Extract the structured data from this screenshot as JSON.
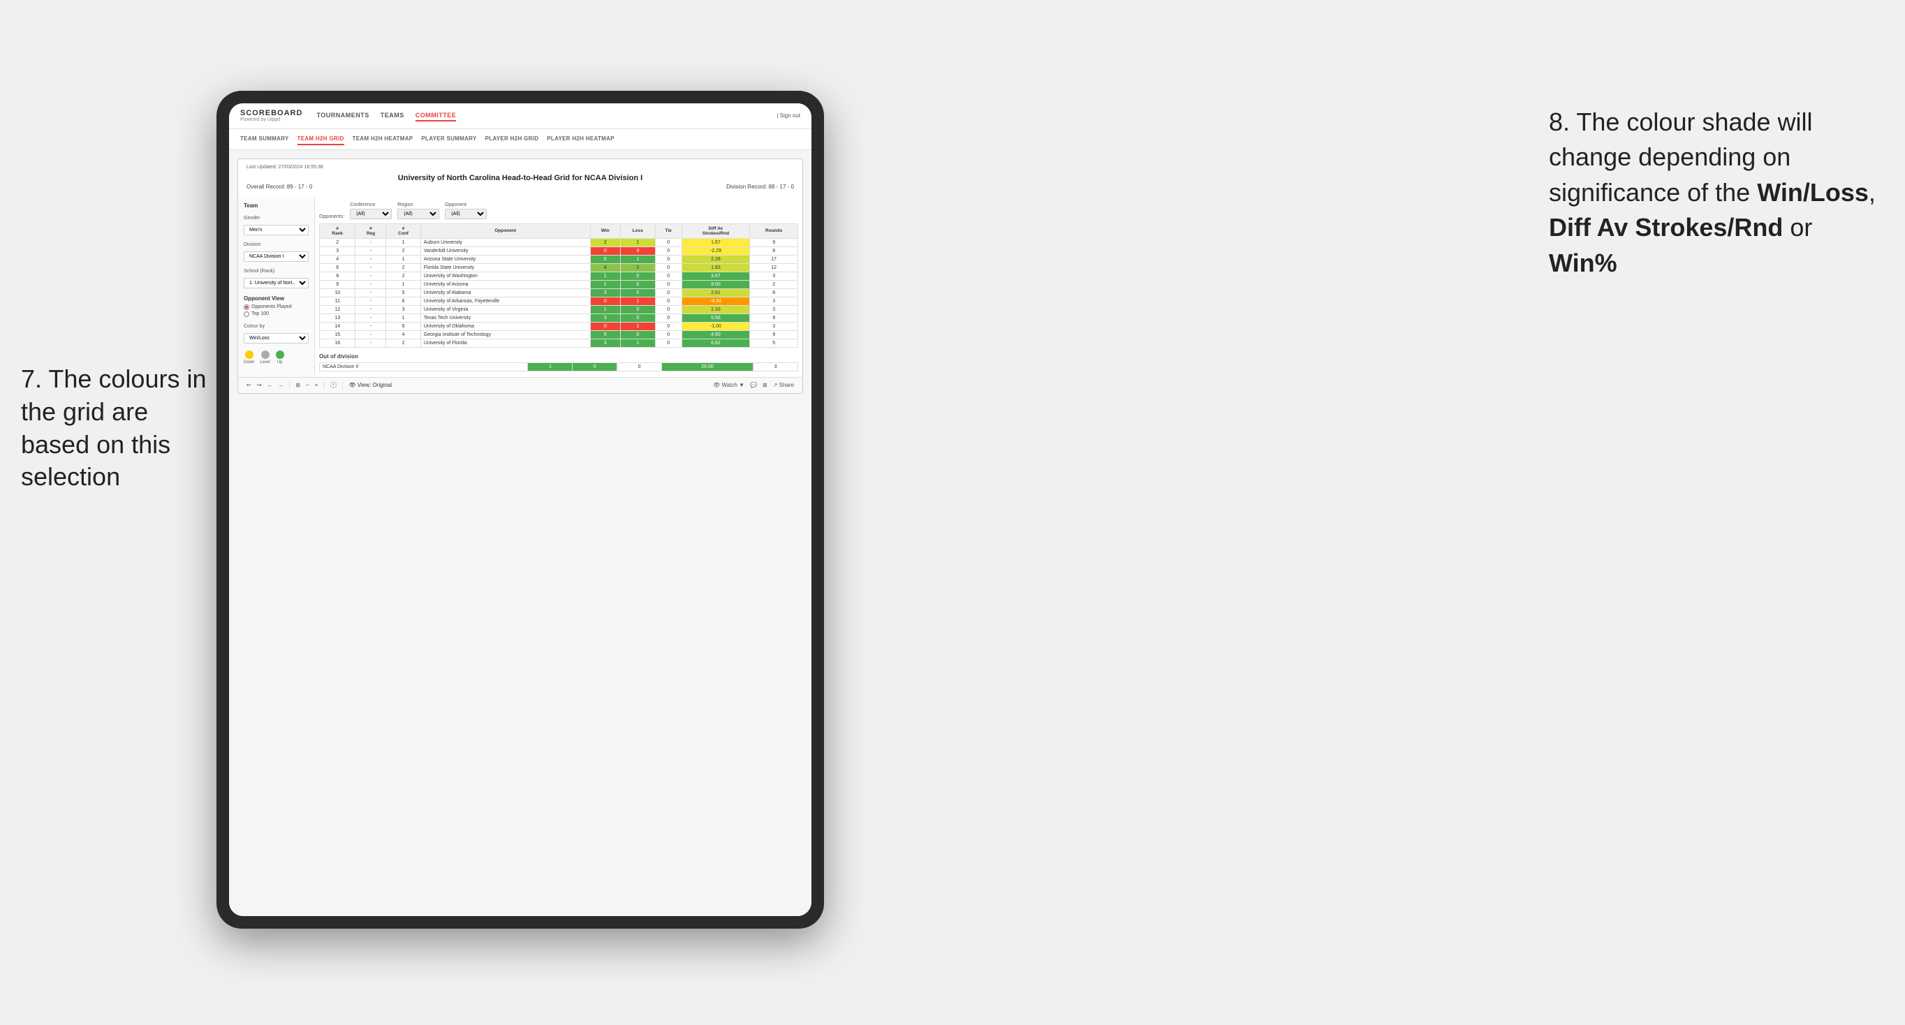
{
  "annotations": {
    "left": {
      "text": "7. The colours in the grid are based on this selection"
    },
    "right": {
      "intro": "8. The colour shade will change depending on significance of the ",
      "bold1": "Win/Loss",
      "sep1": ", ",
      "bold2": "Diff Av Strokes/Rnd",
      "sep2": " or ",
      "bold3": "Win%"
    }
  },
  "nav": {
    "logo": "SCOREBOARD",
    "logo_sub": "Powered by clippd",
    "items": [
      "TOURNAMENTS",
      "TEAMS",
      "COMMITTEE"
    ],
    "sign_out": "Sign out"
  },
  "subnav": {
    "items": [
      "TEAM SUMMARY",
      "TEAM H2H GRID",
      "TEAM H2H HEATMAP",
      "PLAYER SUMMARY",
      "PLAYER H2H GRID",
      "PLAYER H2H HEATMAP"
    ],
    "active": "TEAM H2H GRID"
  },
  "report": {
    "timestamp": "Last Updated: 27/03/2024 16:55:38",
    "title": "University of North Carolina Head-to-Head Grid for NCAA Division I",
    "overall_record": "Overall Record: 89 - 17 - 0",
    "division_record": "Division Record: 88 - 17 - 0"
  },
  "filters": {
    "conference_label": "Conference",
    "conference_value": "(All)",
    "region_label": "Region",
    "region_value": "(All)",
    "opponent_label": "Opponent",
    "opponent_value": "(All)",
    "opponents_label": "Opponents:"
  },
  "side_panel": {
    "team_label": "Team",
    "gender_label": "Gender",
    "gender_value": "Men's",
    "division_label": "Division",
    "division_value": "NCAA Division I",
    "school_label": "School (Rank)",
    "school_value": "1. University of Nort...",
    "opponent_view_label": "Opponent View",
    "radio_options": [
      "Opponents Played",
      "Top 100"
    ],
    "colour_by_label": "Colour by",
    "colour_by_value": "Win/Loss",
    "legend": [
      {
        "label": "Down",
        "color": "#ffcc00"
      },
      {
        "label": "Level",
        "color": "#aaa"
      },
      {
        "label": "Up",
        "color": "#4caf50"
      }
    ]
  },
  "table": {
    "headers": [
      "#\nRank",
      "#\nReg",
      "#\nConf",
      "Opponent",
      "Win",
      "Loss",
      "Tie",
      "Diff Av\nStrokes/Rnd",
      "Rounds"
    ],
    "rows": [
      {
        "rank": "2",
        "reg": "-",
        "conf": "1",
        "opponent": "Auburn University",
        "win": "2",
        "loss": "1",
        "tie": "0",
        "diff": "1.67",
        "rounds": "9",
        "win_color": "green-light",
        "diff_color": "yellow"
      },
      {
        "rank": "3",
        "reg": "-",
        "conf": "2",
        "opponent": "Vanderbilt University",
        "win": "0",
        "loss": "4",
        "tie": "0",
        "diff": "-2.29",
        "rounds": "8",
        "win_color": "red",
        "diff_color": "yellow"
      },
      {
        "rank": "4",
        "reg": "-",
        "conf": "1",
        "opponent": "Arizona State University",
        "win": "5",
        "loss": "1",
        "tie": "0",
        "diff": "2.28",
        "rounds": "17",
        "win_color": "green-dark",
        "diff_color": "green-light"
      },
      {
        "rank": "6",
        "reg": "-",
        "conf": "2",
        "opponent": "Florida State University",
        "win": "4",
        "loss": "2",
        "tie": "0",
        "diff": "1.83",
        "rounds": "12",
        "win_color": "green-mid",
        "diff_color": "green-light"
      },
      {
        "rank": "8",
        "reg": "-",
        "conf": "2",
        "opponent": "University of Washington",
        "win": "1",
        "loss": "0",
        "tie": "0",
        "diff": "3.67",
        "rounds": "3",
        "win_color": "green-dark",
        "diff_color": "green-dark"
      },
      {
        "rank": "9",
        "reg": "-",
        "conf": "1",
        "opponent": "University of Arizona",
        "win": "1",
        "loss": "0",
        "tie": "0",
        "diff": "9.00",
        "rounds": "2",
        "win_color": "green-dark",
        "diff_color": "green-dark"
      },
      {
        "rank": "10",
        "reg": "-",
        "conf": "5",
        "opponent": "University of Alabama",
        "win": "3",
        "loss": "0",
        "tie": "0",
        "diff": "2.61",
        "rounds": "8",
        "win_color": "green-dark",
        "diff_color": "green-light"
      },
      {
        "rank": "11",
        "reg": "-",
        "conf": "6",
        "opponent": "University of Arkansas, Fayetteville",
        "win": "0",
        "loss": "1",
        "tie": "0",
        "diff": "-4.33",
        "rounds": "3",
        "win_color": "red",
        "diff_color": "orange"
      },
      {
        "rank": "12",
        "reg": "-",
        "conf": "3",
        "opponent": "University of Virginia",
        "win": "1",
        "loss": "0",
        "tie": "0",
        "diff": "2.33",
        "rounds": "3",
        "win_color": "green-dark",
        "diff_color": "green-light"
      },
      {
        "rank": "13",
        "reg": "-",
        "conf": "1",
        "opponent": "Texas Tech University",
        "win": "3",
        "loss": "0",
        "tie": "0",
        "diff": "5.56",
        "rounds": "9",
        "win_color": "green-dark",
        "diff_color": "green-dark"
      },
      {
        "rank": "14",
        "reg": "-",
        "conf": "6",
        "opponent": "University of Oklahoma",
        "win": "0",
        "loss": "1",
        "tie": "0",
        "diff": "-1.00",
        "rounds": "3",
        "win_color": "red",
        "diff_color": "yellow"
      },
      {
        "rank": "15",
        "reg": "-",
        "conf": "4",
        "opponent": "Georgia Institute of Technology",
        "win": "5",
        "loss": "0",
        "tie": "0",
        "diff": "4.50",
        "rounds": "9",
        "win_color": "green-dark",
        "diff_color": "green-dark"
      },
      {
        "rank": "16",
        "reg": "-",
        "conf": "2",
        "opponent": "University of Florida",
        "win": "3",
        "loss": "1",
        "tie": "0",
        "diff": "6.62",
        "rounds": "5",
        "win_color": "green-dark",
        "diff_color": "green-dark"
      }
    ]
  },
  "out_of_division": {
    "label": "Out of division",
    "rows": [
      {
        "name": "NCAA Division II",
        "win": "1",
        "loss": "0",
        "tie": "0",
        "diff": "26.00",
        "rounds": "3",
        "win_color": "green-dark",
        "diff_color": "green-dark"
      }
    ]
  },
  "bottom_toolbar": {
    "view_label": "View: Original",
    "watch_label": "Watch",
    "share_label": "Share"
  }
}
